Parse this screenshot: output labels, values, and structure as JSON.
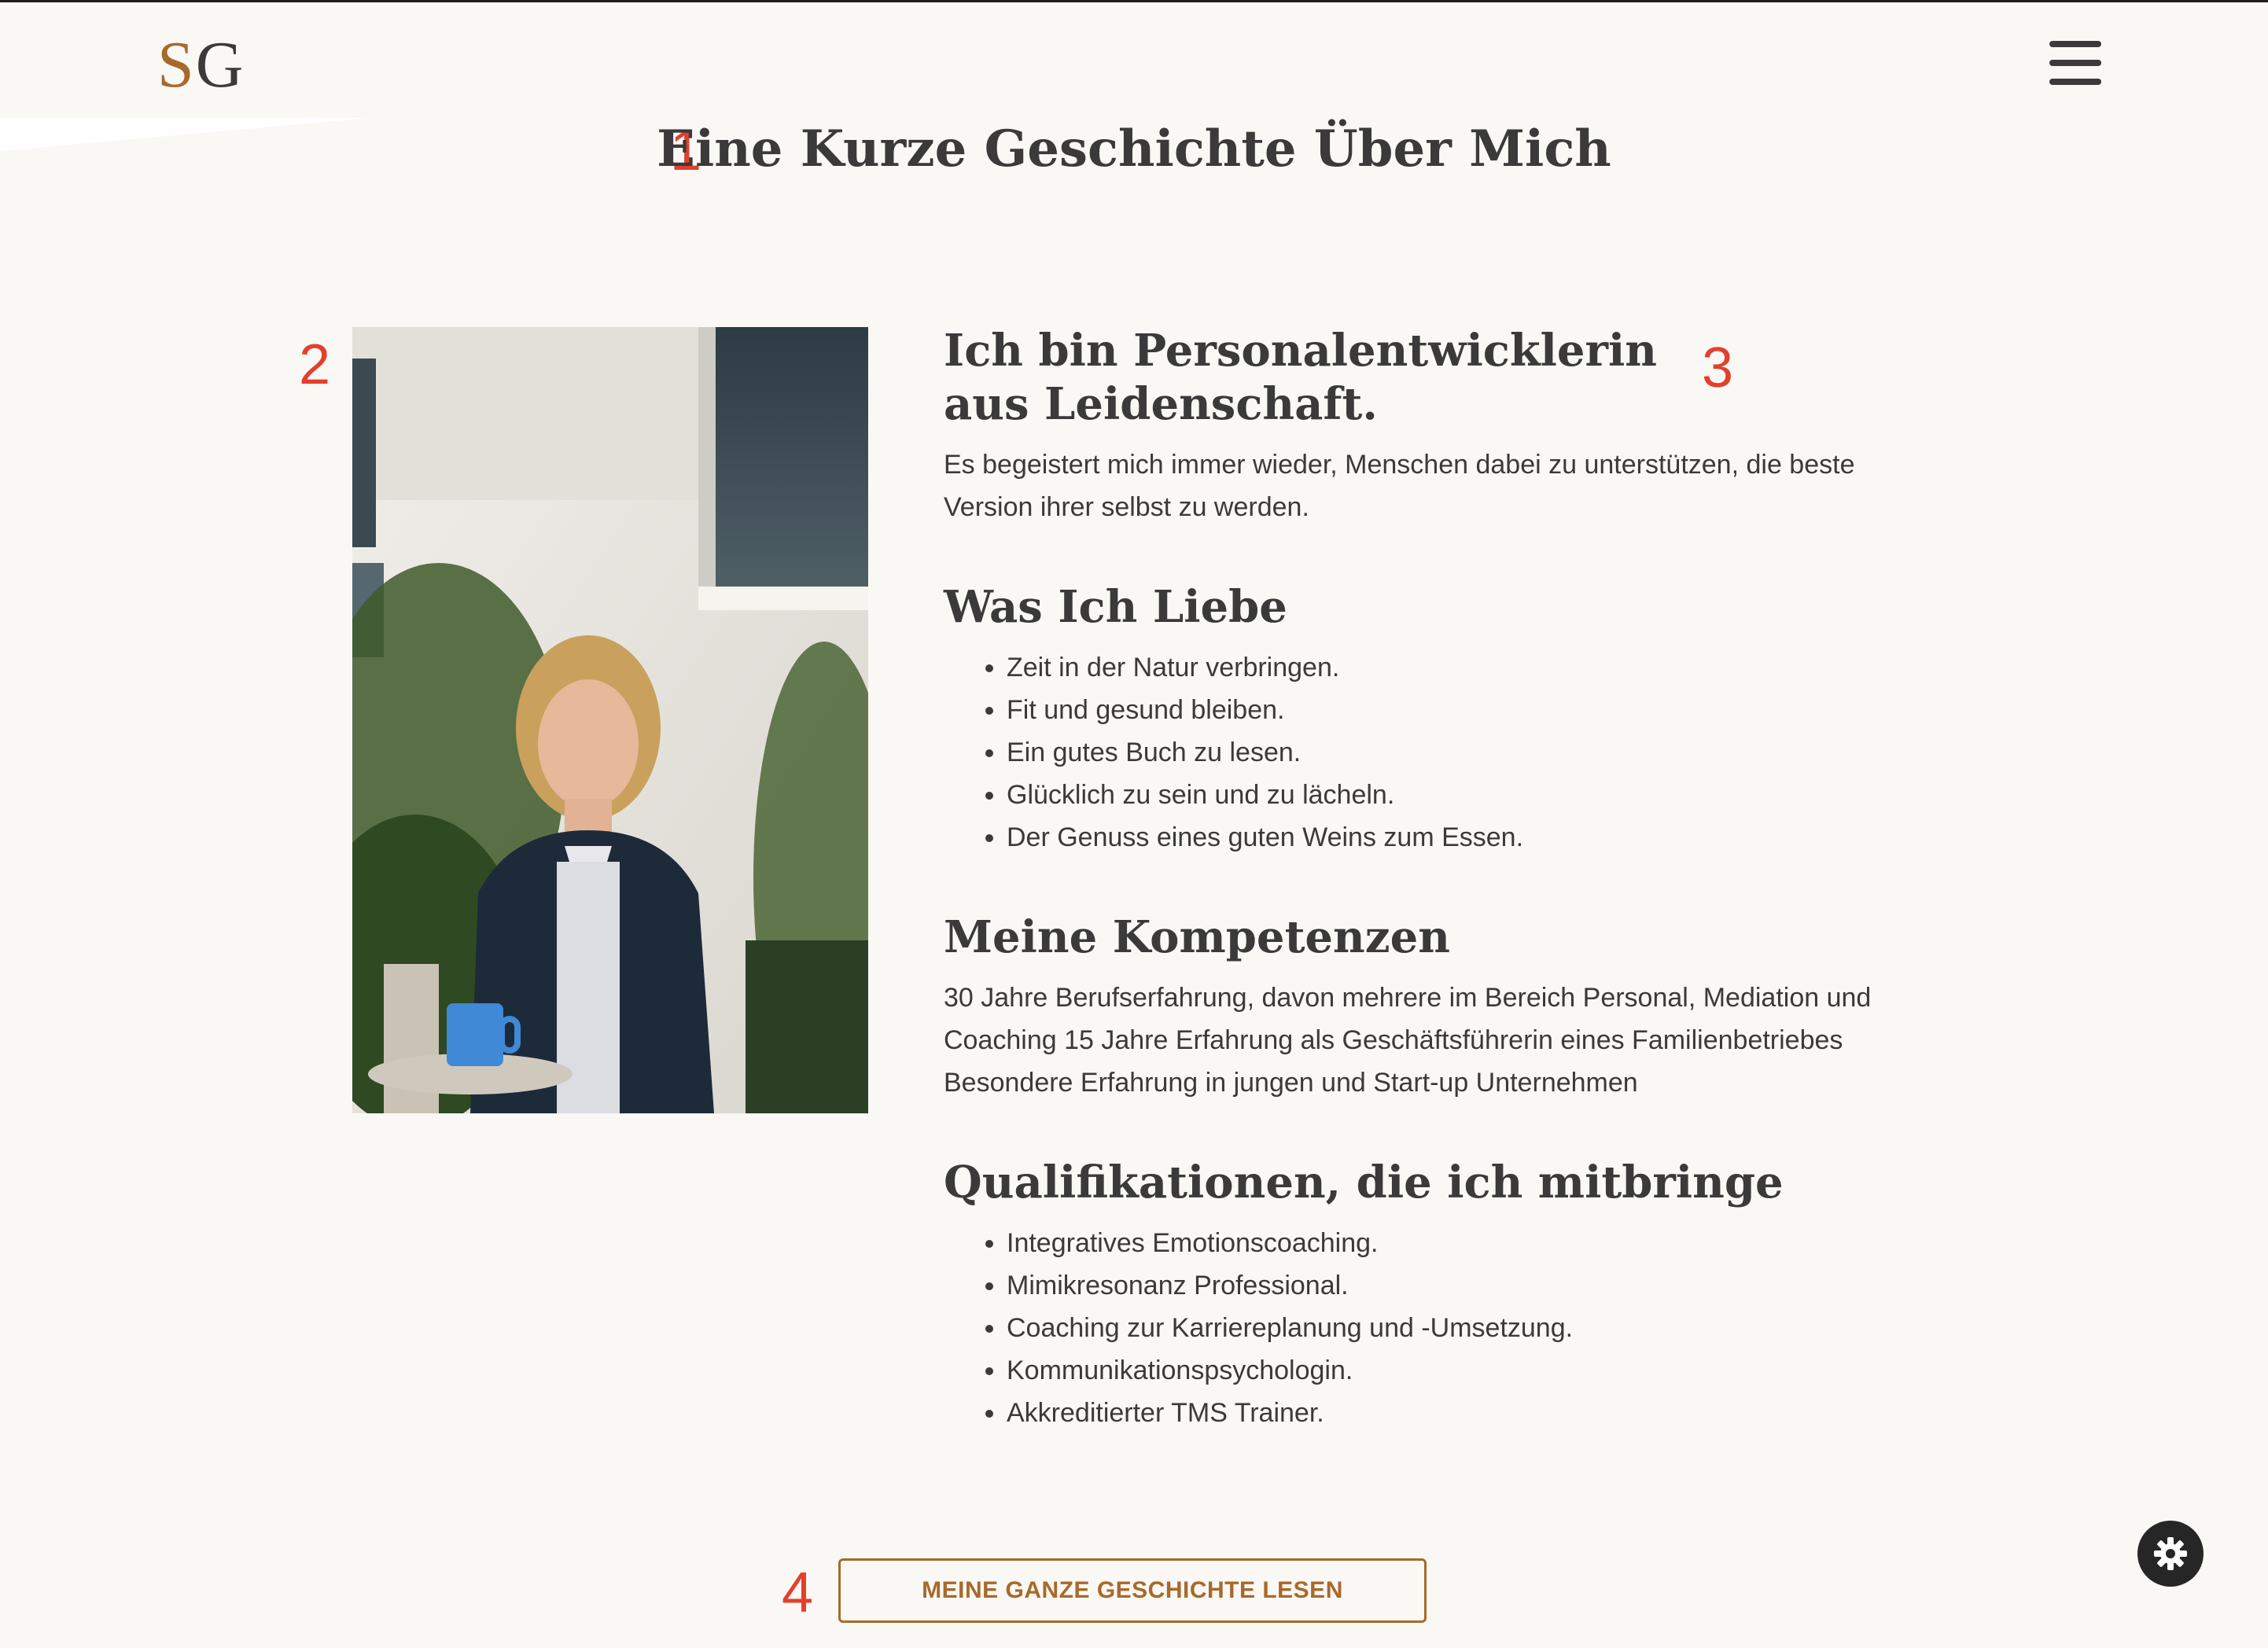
{
  "brand": {
    "logo_s": "S",
    "logo_g": "G",
    "logo_accent_color": "#a8692a"
  },
  "header": {
    "menu_icon": "hamburger-menu-icon"
  },
  "annotations": [
    "1",
    "2",
    "3",
    "4"
  ],
  "page": {
    "title": "Eine Kurze Geschichte Über Mich"
  },
  "about": {
    "intro_heading": "Ich bin Personalentwicklerin aus Leidenschaft.",
    "intro_text": "Es begeistert mich immer wieder, Menschen dabei zu unterstützen, die beste Version ihrer selbst zu werden.",
    "loves_heading": "Was Ich Liebe",
    "loves": [
      "Zeit in der Natur verbringen.",
      "Fit und gesund bleiben.",
      "Ein gutes Buch zu lesen.",
      "Glücklich zu sein und zu lächeln.",
      "Der Genuss eines guten Weins zum Essen."
    ],
    "skills_heading": "Meine Kompetenzen",
    "skills_text": "30 Jahre Berufserfahrung, davon mehrere im Bereich Personal, Mediation und Coaching 15 Jahre Erfahrung als Geschäftsführerin eines Familienbetriebes Besondere Erfahrung in jungen und Start-up Unternehmen",
    "qualifications_heading": "Qualifikationen, die ich mitbringe",
    "qualifications": [
      "Integratives Emotionscoaching.",
      "Mimikresonanz Professional.",
      "Coaching zur Karriereplanung und -Umsetzung.",
      "Kommunikationspsychologin.",
      "Akkreditierter TMS Trainer."
    ]
  },
  "cta": {
    "label": "MEINE GANZE GESCHICHTE LESEN"
  },
  "widgets": {
    "settings_icon": "gear-icon"
  },
  "colors": {
    "background": "#faf8f5",
    "text": "#3a3a3a",
    "accent": "#a8692a",
    "annotation": "#e2402c"
  }
}
